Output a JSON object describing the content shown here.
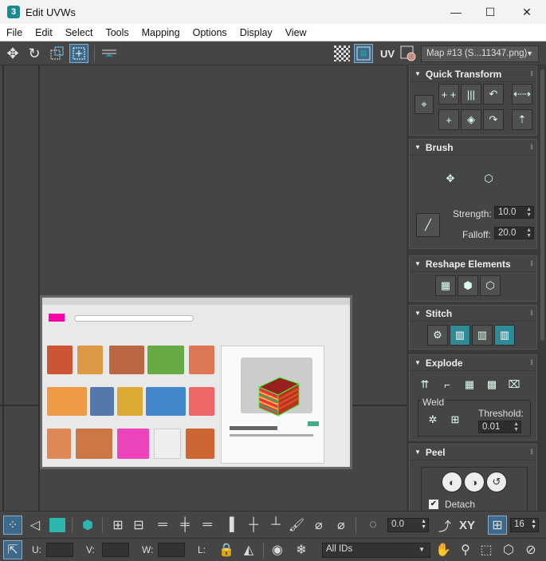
{
  "window": {
    "icon_label": "3",
    "title": "Edit UVWs",
    "minimize": "—",
    "maximize": "☐",
    "close": "✕"
  },
  "menu": [
    "File",
    "Edit",
    "Select",
    "Tools",
    "Mapping",
    "Options",
    "Display",
    "View"
  ],
  "toolbar": {
    "uv_label": "UV",
    "map_select": "Map #13 (S...11347.png)"
  },
  "panel": {
    "quick_transform": {
      "title": "Quick Transform"
    },
    "brush": {
      "title": "Brush",
      "strength_label": "Strength:",
      "strength_value": "10.0",
      "falloff_label": "Falloff:",
      "falloff_value": "20.0"
    },
    "reshape": {
      "title": "Reshape Elements"
    },
    "stitch": {
      "title": "Stitch"
    },
    "explode": {
      "title": "Explode",
      "weld_label": "Weld",
      "threshold_label": "Threshold:",
      "threshold_value": "0.01"
    },
    "peel": {
      "title": "Peel",
      "detach_label": "Detach",
      "detach_checked": true
    }
  },
  "bottom": {
    "rotation_value": "0.0",
    "xy_label": "XY",
    "count_value": "16",
    "u_label": "U:",
    "v_label": "V:",
    "w_label": "W:",
    "l_label": "L:",
    "ids_select": "All IDs"
  },
  "colors": {
    "accent": "#2f8a95",
    "active": "#3d6a8a",
    "bg": "#454545"
  }
}
